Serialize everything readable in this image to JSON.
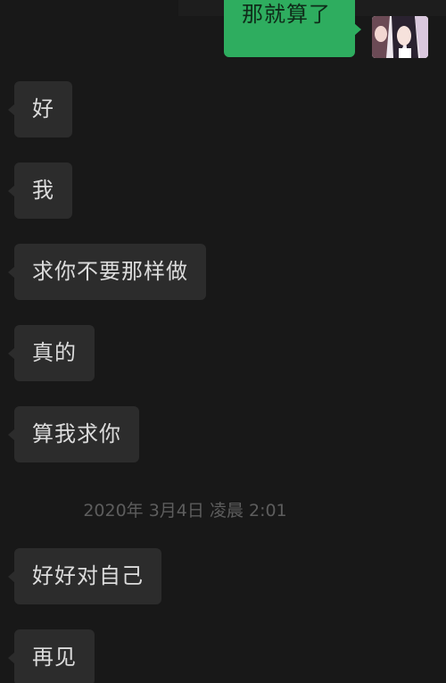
{
  "outgoing": {
    "text": "那就算了",
    "bubble_color": "#2ead5f",
    "avatar_icon": "profile-photo-icon"
  },
  "incoming": [
    {
      "text": "好"
    },
    {
      "text": "我"
    },
    {
      "text": "求你不要那样做"
    },
    {
      "text": "真的"
    },
    {
      "text": "算我求你"
    },
    {
      "text": "好好对自己"
    },
    {
      "text": "再见"
    }
  ],
  "timestamp": "2020年 3月4日 凌晨 2:01",
  "colors": {
    "background": "#181818",
    "incoming_bubble": "#2c2c2c",
    "outgoing_bubble": "#2ead5f",
    "timestamp_text": "#5d5d5d"
  }
}
